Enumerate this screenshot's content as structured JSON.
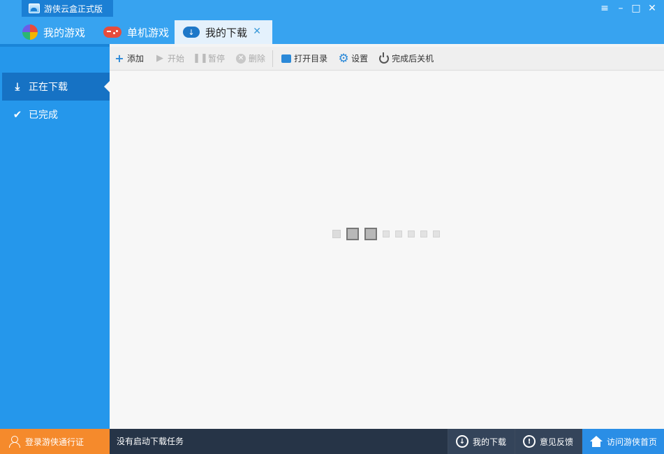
{
  "window": {
    "title": "游侠云盒正式版",
    "controls": {
      "menu": "≡",
      "minimize": "–",
      "maximize": "□",
      "close": "✕"
    }
  },
  "tabs": [
    {
      "label": "我的游戏",
      "icon": "games-icon"
    },
    {
      "label": "单机游戏",
      "icon": "gamepad-icon"
    },
    {
      "label": "我的下载",
      "icon": "cloud-download-icon",
      "active": true,
      "close": "✕"
    }
  ],
  "sidebar": {
    "items": [
      {
        "label": "正在下载",
        "icon": "download-icon",
        "selected": true
      },
      {
        "label": "已完成",
        "icon": "check-icon"
      }
    ]
  },
  "toolbar": {
    "add": "添加",
    "start": "开始",
    "pause": "暂停",
    "delete": "删除",
    "open_dir": "打开目录",
    "settings": "设置",
    "shutdown_after": "完成后关机"
  },
  "statusbar": {
    "login": "登录游侠通行证",
    "status": "没有启动下载任务",
    "my_downloads": "我的下载",
    "feedback": "意见反馈",
    "home": "访问游侠首页"
  },
  "colors": {
    "accent": "#37a3f0",
    "sidebar": "#2597eb",
    "sidebar_selected": "#1672c4",
    "statusbar": "#263447",
    "login_orange": "#f58a2c",
    "home_blue": "#2a8ee6"
  }
}
